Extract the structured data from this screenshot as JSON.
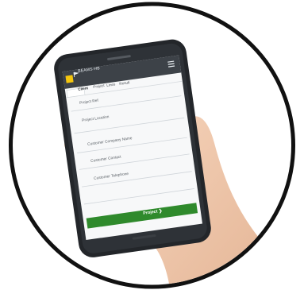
{
  "app": {
    "title": "BEAMS-HB",
    "menu_icon": "hamburger-menu-icon",
    "logo_icon": "yellow-square-logo-icon",
    "flag_icon": "flag-icon"
  },
  "tabs": [
    {
      "label": "Client",
      "active": true
    },
    {
      "label": "Project",
      "active": false
    },
    {
      "label": "Lines",
      "active": false
    },
    {
      "label": "Result",
      "active": false
    }
  ],
  "fields": [
    {
      "label": "Project Ref",
      "value": ""
    },
    {
      "label": "Project Location",
      "value": ""
    },
    {
      "label": "Customer Company Name",
      "value": ""
    },
    {
      "label": "Customer Contact",
      "value": ""
    },
    {
      "label": "Customer Telephone",
      "value": ""
    }
  ],
  "primary_button": {
    "label": "Project ❯"
  },
  "colors": {
    "header": "#3d4248",
    "accent_yellow": "#f5c60e",
    "button_green": "#2f8a2c",
    "phone_body": "#23262a",
    "skin": "#f0c8ac",
    "circle_border": "#111111"
  }
}
